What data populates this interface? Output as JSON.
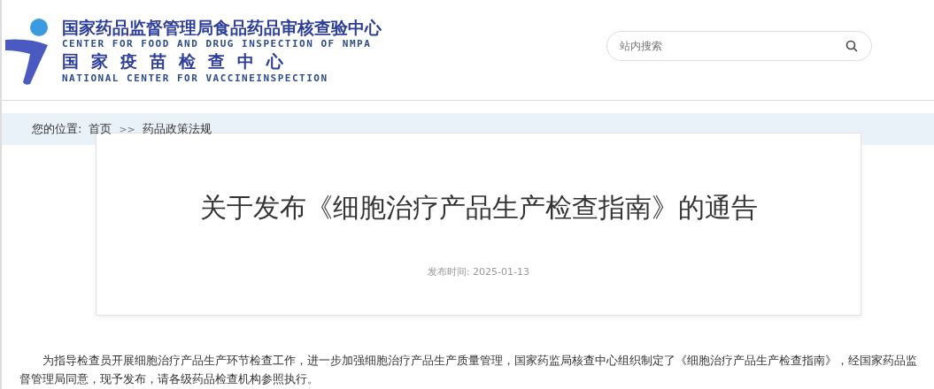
{
  "header": {
    "org_name_cn": "国家药品监督管理局食品药品审核查验中心",
    "org_name_en": "CENTER FOR FOOD AND DRUG INSPECTION OF NMPA",
    "center_name_cn": "国家疫苗检查中心",
    "center_name_en": "NATIONAL CENTER FOR VACCINEINSPECTION",
    "search": {
      "placeholder": "站内搜索"
    }
  },
  "breadcrumb": {
    "label": "您的位置:",
    "items": [
      "首页",
      "药品政策法规"
    ],
    "separator": ">>"
  },
  "article": {
    "title": "关于发布《细胞治疗产品生产检查指南》的通告",
    "date_label": "发布时间:",
    "date": "2025-01-13",
    "body": "为指导检查员开展细胞治疗产品生产环节检查工作，进一步加强细胞治疗产品生产质量管理，国家药监局核查中心组织制定了《细胞治疗产品生产检查指南》，经国家药品监督管理局同意，现予发布，请各级药品检查机构参照执行。"
  }
}
